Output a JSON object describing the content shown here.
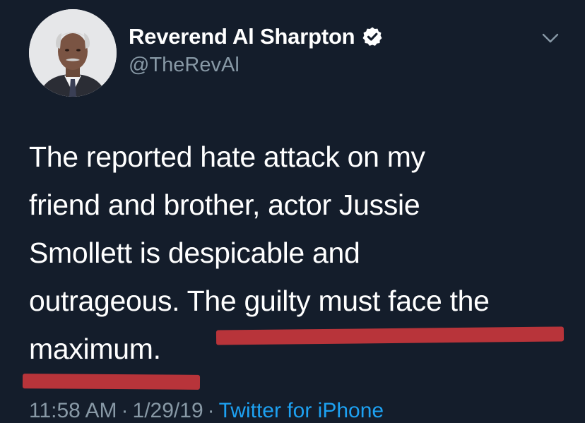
{
  "tweet": {
    "display_name": "Reverend Al Sharpton",
    "handle": "@TheRevAl",
    "verified": true,
    "avatar_icon": "profile-photo",
    "menu_icon": "chevron-down-icon",
    "text": "The reported hate attack on my\nfriend and brother, actor Jussie\nSmollett is despicable and\noutrageous. The guilty must face the\nmaximum.",
    "time": "11:58 AM",
    "date": "1/29/19",
    "separator": "·",
    "source": "Twitter for iPhone"
  },
  "colors": {
    "background": "#141d2b",
    "text": "#ffffff",
    "secondary_text": "#8899a6",
    "link": "#1da1f2",
    "highlight_underline": "#b8343a"
  }
}
